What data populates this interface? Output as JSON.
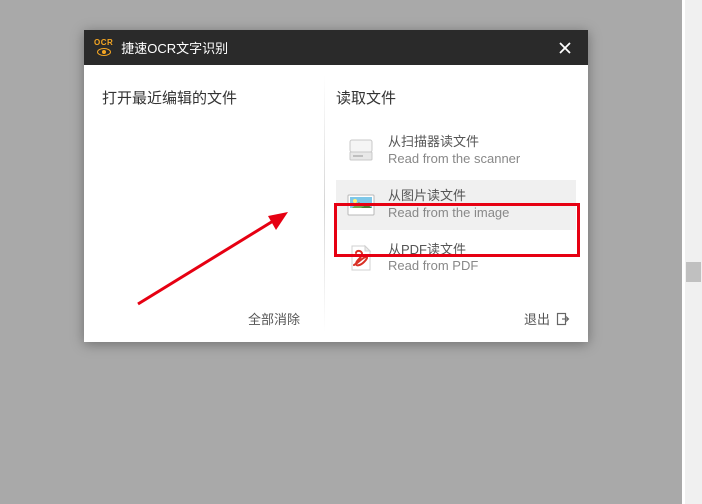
{
  "titlebar": {
    "ocr_label": "OCR",
    "title": "捷速OCR文字识别"
  },
  "left_panel": {
    "heading": "打开最近编辑的文件",
    "clear_all": "全部消除"
  },
  "right_panel": {
    "heading": "读取文件",
    "options": [
      {
        "title": "从扫描器读文件",
        "subtitle": "Read from the scanner"
      },
      {
        "title": "从图片读文件",
        "subtitle": "Read from the image"
      },
      {
        "title": "从PDF读文件",
        "subtitle": "Read from PDF"
      }
    ],
    "exit": "退出"
  }
}
